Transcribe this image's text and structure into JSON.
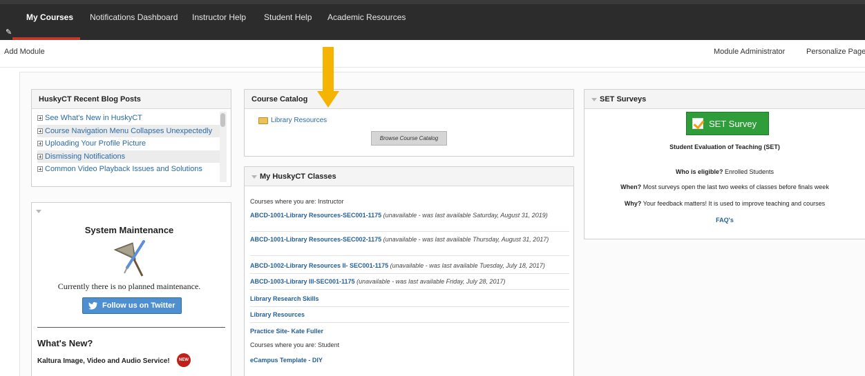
{
  "nav": {
    "tabs": [
      {
        "label": "My Courses",
        "active": true
      },
      {
        "label": "Notifications Dashboard"
      },
      {
        "label": "Instructor Help"
      },
      {
        "label": "Student Help"
      },
      {
        "label": "Academic Resources"
      }
    ]
  },
  "subbar": {
    "add_module": "Add Module",
    "module_admin": "Module Administrator",
    "personalize": "Personalize Page"
  },
  "blog": {
    "title": "HuskyCT Recent Blog Posts",
    "items": [
      "See What's New in HuskyCT",
      "Course Navigation Menu Collapses Unexpectedly",
      "Uploading Your Profile Picture",
      "Dismissing Notifications",
      "Common Video Playback Issues and Solutions"
    ]
  },
  "maintenance": {
    "title": "System Maintenance",
    "text": "Currently there is no planned maintenance.",
    "twitter_button": "Follow us on Twitter",
    "whats_new": "What's New?",
    "kaltura": "Kaltura Image, Video and Audio Service!",
    "badge": "NEW"
  },
  "catalog": {
    "title": "Course Catalog",
    "folder_link": "Library Resources",
    "browse_button": "Browse Course Catalog"
  },
  "classes": {
    "title": "My HuskyCT Classes",
    "instructor_label": "Courses where you are: Instructor",
    "student_label": "Courses where you are: Student",
    "rows": [
      {
        "name": "ABCD-1001-Library Resources-SEC001-1175",
        "note": "(unavailable - was last available Saturday, August 31, 2019)"
      },
      {
        "name": "ABCD-1001-Library Resources-SEC002-1175",
        "note": "(unavailable - was last available Thursday, August 31, 2017)"
      },
      {
        "name": "ABCD-1002-Library Resources II- SEC001-1175",
        "note": "(unavailable - was last available Tuesday, July 18, 2017)"
      },
      {
        "name": "ABCD-1003-Library III-SEC001-1175",
        "note": "(unavailable - was last available Friday, July 28, 2017)"
      },
      {
        "name": "Library Research Skills",
        "note": ""
      },
      {
        "name": "Library Resources",
        "note": ""
      },
      {
        "name": "Practice Site- Kate Fuller",
        "note": ""
      }
    ],
    "student_rows": [
      {
        "name": "eCampus Template - DIY"
      }
    ]
  },
  "set": {
    "title": "SET Surveys",
    "button": "SET Survey",
    "subtitle": "Student Evaluation of Teaching (SET)",
    "eligible_label": "Who is eligible?",
    "eligible_text": "Enrolled Students",
    "when_label": "When?",
    "when_text": "Most surveys open the last two weeks of classes before finals week",
    "why_label": "Why?",
    "why_text": "Your feedback matters! It is used to improve teaching and courses",
    "faq": "FAQ's"
  },
  "colors": {
    "nav_bg": "#2c2c2c",
    "accent_red": "#c0392b",
    "link_blue": "#2a6aa8",
    "arrow_yellow": "#f5b400",
    "set_green": "#2f9e3a"
  }
}
